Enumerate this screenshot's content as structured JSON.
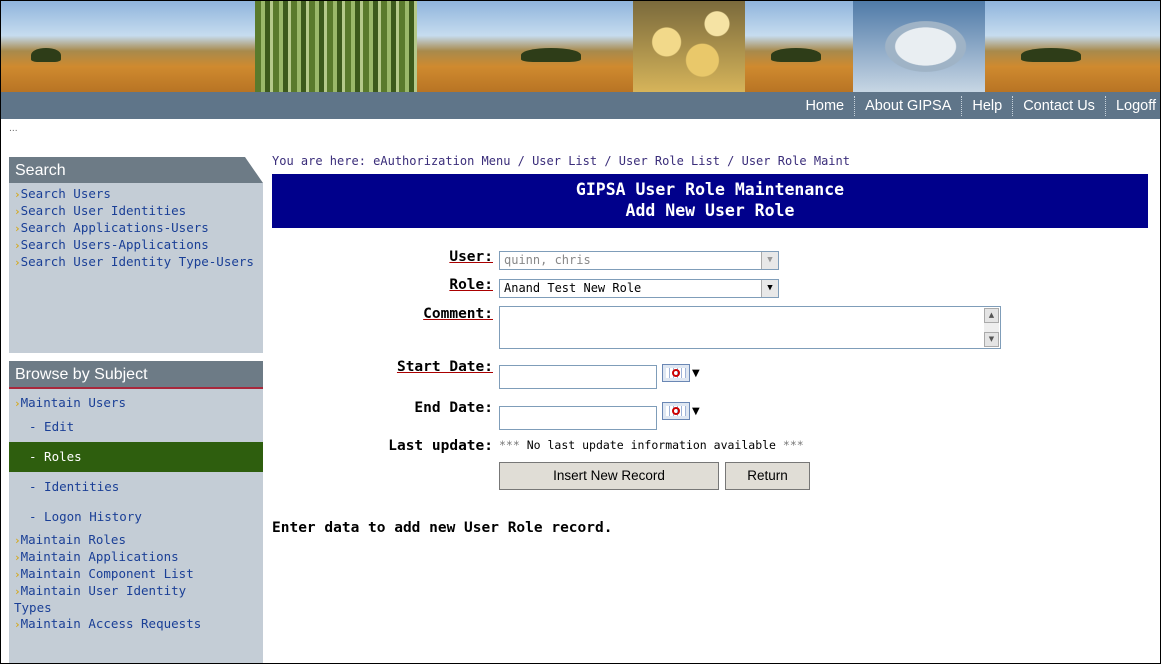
{
  "nav": {
    "links": [
      {
        "label": "Home"
      },
      {
        "label": "About GIPSA"
      },
      {
        "label": "Help"
      },
      {
        "label": "Contact Us"
      },
      {
        "label": "Logoff"
      }
    ]
  },
  "sidebar": {
    "dots": "...",
    "search_heading": "Search",
    "search_items": [
      "Search Users",
      "Search User Identities",
      "Search Applications-Users",
      "Search Users-Applications",
      "Search User Identity Type-Users"
    ],
    "browse_heading": "Browse by Subject",
    "browse": {
      "maintain_users": "Maintain Users",
      "subitems": [
        "- Edit",
        "- Roles",
        "- Identities",
        "- Logon History"
      ],
      "active_subitem": "- Roles",
      "items": [
        "Maintain Roles",
        "Maintain Applications",
        "Maintain Component List",
        "Maintain User Identity Types",
        "Maintain Access Requests"
      ]
    }
  },
  "main": {
    "breadcrumb": "You are here: eAuthorization Menu / User List / User Role List / User Role Maint",
    "title_line1": "GIPSA User Role Maintenance",
    "title_line2": "Add New User Role",
    "form": {
      "user_label": "User:",
      "user_value": "quinn, chris",
      "role_label": "Role:",
      "role_value": "Anand Test New Role",
      "comment_label": "Comment:",
      "comment_value": "",
      "start_label": "Start Date:",
      "start_value": "",
      "end_label": "End Date:",
      "end_value": "",
      "last_update_label": "Last update:",
      "last_update_stars": "***",
      "last_update_text": "No last update information available"
    },
    "buttons": {
      "insert": "Insert New Record",
      "return": "Return"
    },
    "status": "Enter data to add new User Role record."
  },
  "colors": {
    "title_bar": "#00008b",
    "nav_bar": "#5f7589",
    "sidebar_bg": "#c4cdd6",
    "active_item": "#2e5e0e",
    "link": "#1a3f96"
  },
  "icons": [
    "calendar-icon",
    "dropdown-arrow-icon",
    "bullet-arrow-icon",
    "scroll-up-icon",
    "scroll-down-icon"
  ]
}
